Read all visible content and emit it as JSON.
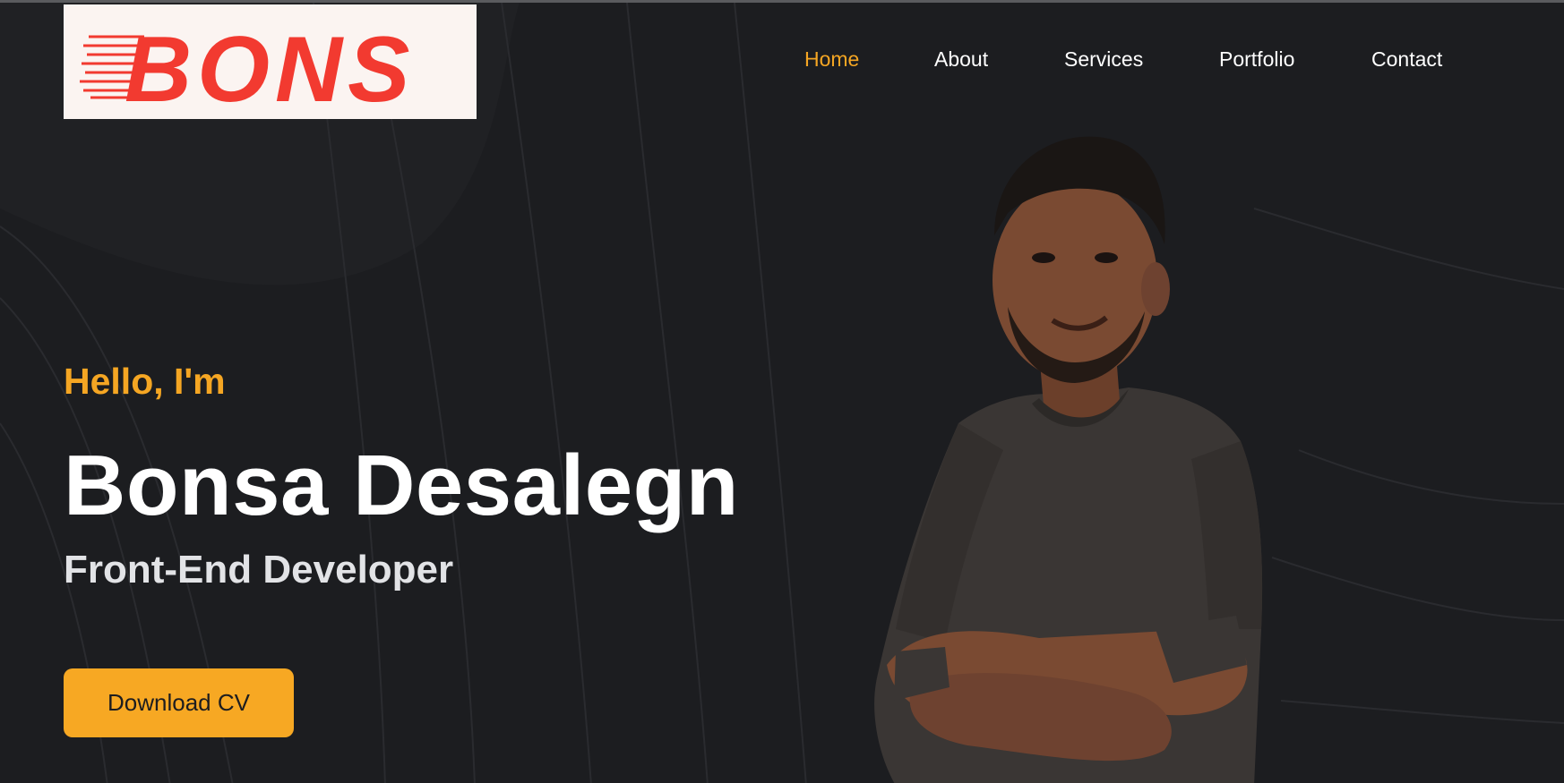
{
  "logo": {
    "text": "BONS",
    "color": "#f23a30",
    "background": "#fbf4f1"
  },
  "nav": {
    "items": [
      {
        "label": "Home",
        "active": true
      },
      {
        "label": "About",
        "active": false
      },
      {
        "label": "Services",
        "active": false
      },
      {
        "label": "Portfolio",
        "active": false
      },
      {
        "label": "Contact",
        "active": false
      }
    ]
  },
  "hero": {
    "greeting": "Hello, I'm",
    "name": "Bonsa Desalegn",
    "role": "Front-End Developer",
    "cta_label": "Download CV"
  },
  "theme": {
    "background": "#1c1d20",
    "accent": "#f5a623",
    "text": "#ffffff"
  },
  "icons": {
    "portrait": "developer-portrait-image"
  }
}
